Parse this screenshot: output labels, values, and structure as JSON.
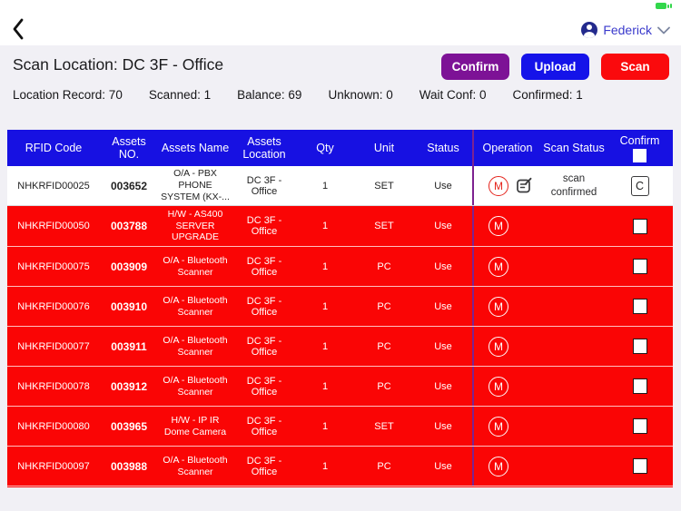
{
  "colors": {
    "bg_light": "#f1f0f5",
    "table_header_blue": "#1711e2",
    "row_red": "#fa0505",
    "divider_purple": "#7d2290",
    "confirm_purple": "#7d1296",
    "upload_blue": "#1513e9",
    "scan_red": "#fa0a0d",
    "accent_user_blue": "#3a3acc",
    "battery_green": "#32d74b",
    "m_icon_red": "#e5231b"
  },
  "status_bar": {
    "battery_icon": "battery-green"
  },
  "nav": {
    "back_icon": "chevron-left",
    "user": {
      "avatar_icon": "person",
      "name": "Federick",
      "dropdown_icon": "chevron-down"
    }
  },
  "header": {
    "title": "Scan Location: DC 3F - Office",
    "buttons": [
      {
        "label": "Confirm",
        "color_key": "confirm_purple"
      },
      {
        "label": "Upload",
        "color_key": "upload_blue"
      },
      {
        "label": "Scan",
        "color_key": "scan_red"
      }
    ]
  },
  "stats": [
    "Location Record: 70",
    "Scanned: 1",
    "Balance: 69",
    "Unknown: 0",
    "Wait Conf: 0",
    "Confirmed: 1"
  ],
  "table": {
    "columns": [
      "RFID Code",
      "Assets NO.",
      "Assets Name",
      "Assets Location",
      "Qty",
      "Unit",
      "Status",
      "Operation",
      "Scan Status",
      "Confirm"
    ],
    "header_checkbox_checked": false,
    "rows": [
      {
        "rfid": "NHKRFID00025",
        "assets_no": "003652",
        "name": "O/A - PBX PHONE SYSTEM (KX-...",
        "location": "DC 3F - Office",
        "qty": "1",
        "unit": "SET",
        "status": "Use",
        "highlighted": false,
        "operation_icons": [
          "m-circle-icon",
          "edit-note-icon"
        ],
        "scan_status": "scan confirmed",
        "confirm": {
          "type": "c-button",
          "label": "C"
        }
      },
      {
        "rfid": "NHKRFID00050",
        "assets_no": "003788",
        "name": "H/W - AS400 SERVER UPGRADE",
        "location": "DC 3F - Office",
        "qty": "1",
        "unit": "SET",
        "status": "Use",
        "highlighted": true,
        "operation_icons": [
          "m-circle-icon"
        ],
        "scan_status": "",
        "confirm": {
          "type": "checkbox",
          "checked": false
        }
      },
      {
        "rfid": "NHKRFID00075",
        "assets_no": "003909",
        "name": "O/A - Bluetooth Scanner",
        "location": "DC 3F - Office",
        "qty": "1",
        "unit": "PC",
        "status": "Use",
        "highlighted": true,
        "operation_icons": [
          "m-circle-icon"
        ],
        "scan_status": "",
        "confirm": {
          "type": "checkbox",
          "checked": false
        }
      },
      {
        "rfid": "NHKRFID00076",
        "assets_no": "003910",
        "name": "O/A - Bluetooth Scanner",
        "location": "DC 3F - Office",
        "qty": "1",
        "unit": "PC",
        "status": "Use",
        "highlighted": true,
        "operation_icons": [
          "m-circle-icon"
        ],
        "scan_status": "",
        "confirm": {
          "type": "checkbox",
          "checked": false
        }
      },
      {
        "rfid": "NHKRFID00077",
        "assets_no": "003911",
        "name": "O/A - Bluetooth Scanner",
        "location": "DC 3F - Office",
        "qty": "1",
        "unit": "PC",
        "status": "Use",
        "highlighted": true,
        "operation_icons": [
          "m-circle-icon"
        ],
        "scan_status": "",
        "confirm": {
          "type": "checkbox",
          "checked": false
        }
      },
      {
        "rfid": "NHKRFID00078",
        "assets_no": "003912",
        "name": "O/A - Bluetooth Scanner",
        "location": "DC 3F - Office",
        "qty": "1",
        "unit": "PC",
        "status": "Use",
        "highlighted": true,
        "operation_icons": [
          "m-circle-icon"
        ],
        "scan_status": "",
        "confirm": {
          "type": "checkbox",
          "checked": false
        }
      },
      {
        "rfid": "NHKRFID00080",
        "assets_no": "003965",
        "name": "H/W - IP IR Dome Camera",
        "location": "DC 3F - Office",
        "qty": "1",
        "unit": "SET",
        "status": "Use",
        "highlighted": true,
        "operation_icons": [
          "m-circle-icon"
        ],
        "scan_status": "",
        "confirm": {
          "type": "checkbox",
          "checked": false
        }
      },
      {
        "rfid": "NHKRFID00097",
        "assets_no": "003988",
        "name": "O/A - Bluetooth Scanner",
        "location": "DC 3F - Office",
        "qty": "1",
        "unit": "PC",
        "status": "Use",
        "highlighted": true,
        "operation_icons": [
          "m-circle-icon"
        ],
        "scan_status": "",
        "confirm": {
          "type": "checkbox",
          "checked": false
        }
      }
    ]
  }
}
